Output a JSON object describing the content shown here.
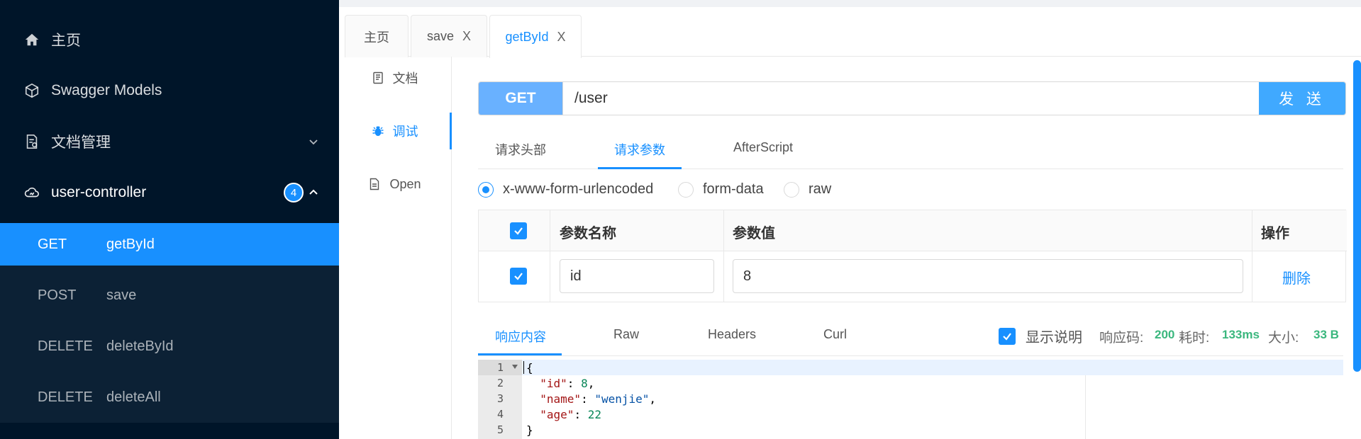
{
  "sidebar": {
    "home_label": "主页",
    "models_label": "Swagger Models",
    "docs_label": "文档管理",
    "controller_label": "user-controller",
    "controller_badge": "4",
    "apis": [
      {
        "method": "GET",
        "name": "getById"
      },
      {
        "method": "POST",
        "name": "save"
      },
      {
        "method": "DELETE",
        "name": "deleteById"
      },
      {
        "method": "DELETE",
        "name": "deleteAll"
      }
    ]
  },
  "tabs": [
    {
      "label": "主页",
      "closable": false
    },
    {
      "label": "save",
      "closable": true
    },
    {
      "label": "getById",
      "closable": true
    }
  ],
  "close_glyph": "X",
  "side_menu": {
    "doc_label": "文档",
    "debug_label": "调试",
    "open_label": "Open"
  },
  "request": {
    "method": "GET",
    "url": "/user",
    "send_label": "发 送"
  },
  "sub_tabs": [
    "请求头部",
    "请求参数",
    "AfterScript"
  ],
  "body_types": [
    "x-www-form-urlencoded",
    "form-data",
    "raw"
  ],
  "params_table": {
    "headers": [
      "参数名称",
      "参数值",
      "操作"
    ],
    "rows": [
      {
        "name": "id",
        "value": "8",
        "action": "删除"
      }
    ]
  },
  "response": {
    "tabs": [
      "响应内容",
      "Raw",
      "Headers",
      "Curl"
    ],
    "show_desc_label": "显示说明",
    "status_label": "响应码:",
    "status_value": "200",
    "time_label": "耗时:",
    "time_value": "133ms",
    "size_label": "大小:",
    "size_value": "33 B",
    "line_numbers": [
      "1",
      "2",
      "3",
      "4",
      "5"
    ],
    "body_lines": [
      "{",
      "  \"id\": 8,",
      "  \"name\": \"wenjie\",",
      "  \"age\": 22",
      "}"
    ]
  },
  "colors": {
    "sidebar_bg": "#001529",
    "accent": "#1890ff",
    "status_green": "#3bb77e"
  }
}
